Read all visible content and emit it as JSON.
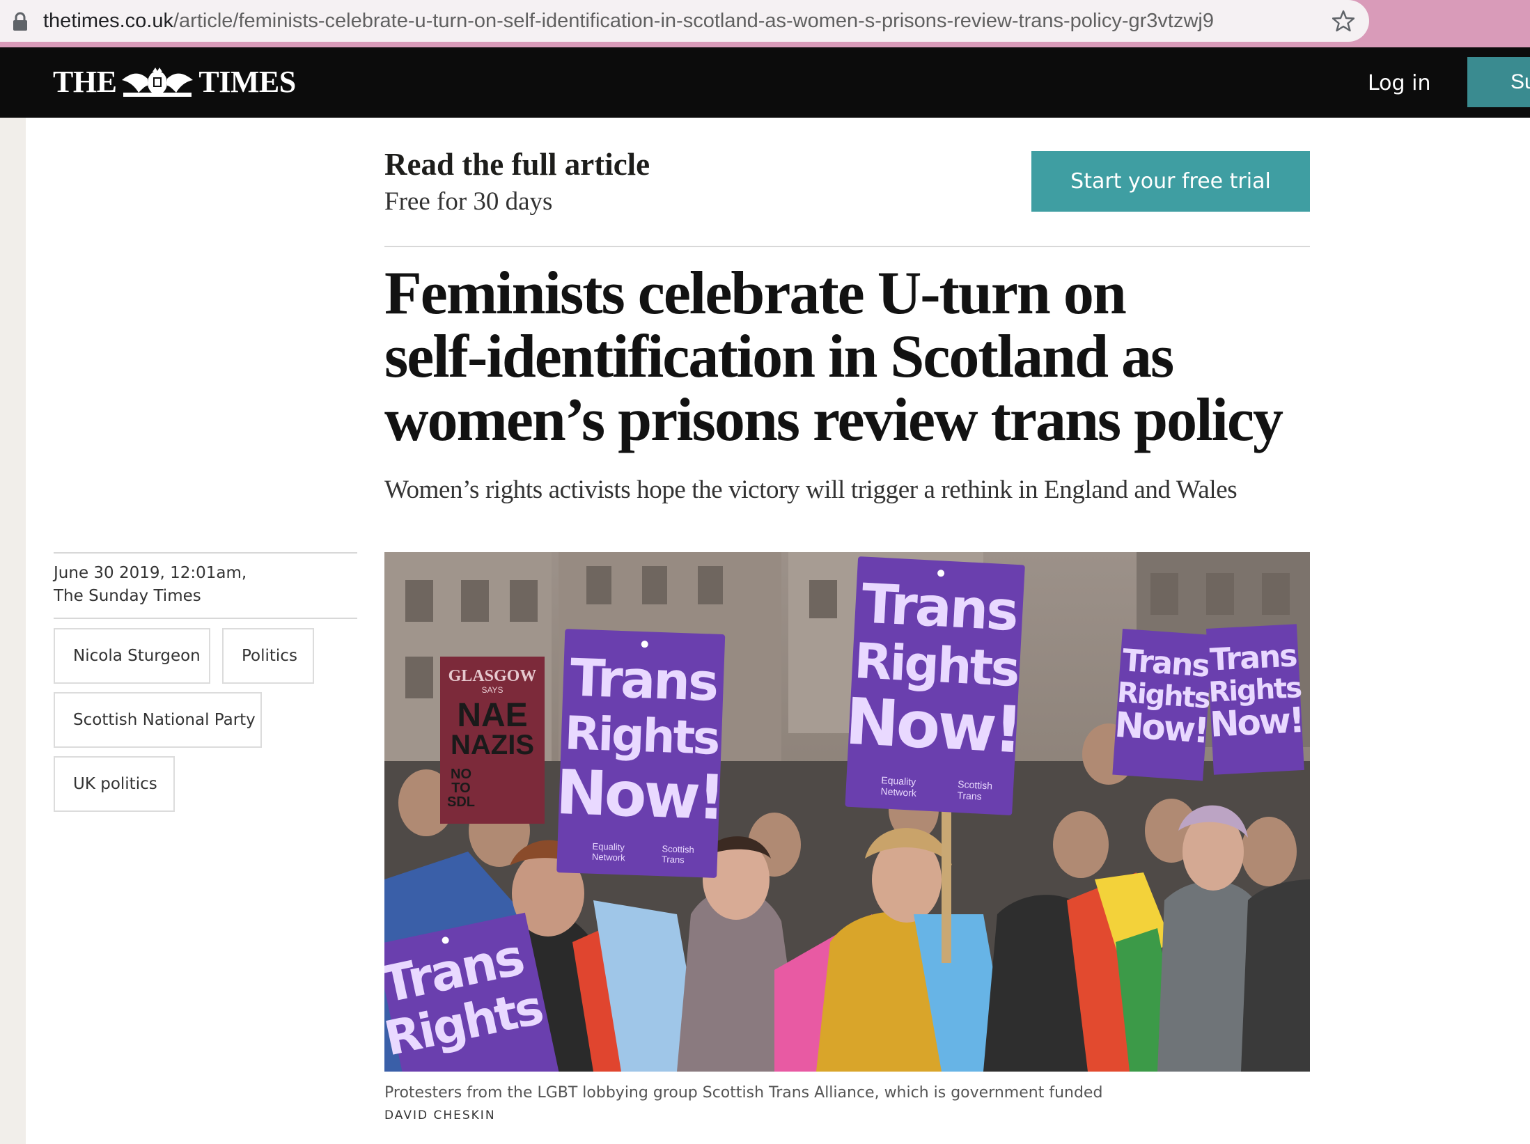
{
  "browser": {
    "url_domain": "thetimes.co.uk",
    "url_path": "/article/feminists-celebrate-u-turn-on-self-identification-in-scotland-as-women-s-prisons-review-trans-policy-gr3vtzwj9"
  },
  "header": {
    "logo_left": "THE",
    "logo_right": "TIMES",
    "login_label": "Log in",
    "subscribe_label": "Su"
  },
  "promo": {
    "title": "Read the full article",
    "subtitle": "Free for 30 days",
    "trial_button": "Start your free trial",
    "trial_button_color": "#3f9ea2"
  },
  "article": {
    "headline_lines": [
      "Feminists celebrate U-turn on",
      "self-identification in Scotland as",
      "women’s prisons review trans policy"
    ],
    "standfirst": "Women’s rights activists hope the victory will trigger a rethink in England and Wales",
    "date": "June 30 2019, 12:01am,",
    "publication": "The Sunday Times",
    "tags": [
      "Nicola Sturgeon",
      "Politics",
      "Scottish National Party",
      "UK politics"
    ],
    "caption": "Protesters from the LGBT lobbying group Scottish Trans Alliance, which is government funded",
    "credit": "DAVID CHESKIN"
  },
  "photo": {
    "placard_main": [
      "Trans",
      "Rights",
      "Now!"
    ],
    "placard_bottom": [
      "Trans",
      "Rights"
    ],
    "placard_small": [
      "Trans",
      "Rights",
      "Now!"
    ],
    "sign_glasgow": "GLASGOW",
    "sign_says": "SAYS",
    "sign_nae": "NAE",
    "sign_nazis": "NAZIS",
    "sign_no": "NO",
    "sign_to": "TO",
    "sign_sdl": "SDL",
    "logo_equality_1": "Equality",
    "logo_equality_2": "Network",
    "logo_scottish_1": "Scottish",
    "logo_scottish_2": "Trans",
    "placard_color": "#6a3fae"
  }
}
